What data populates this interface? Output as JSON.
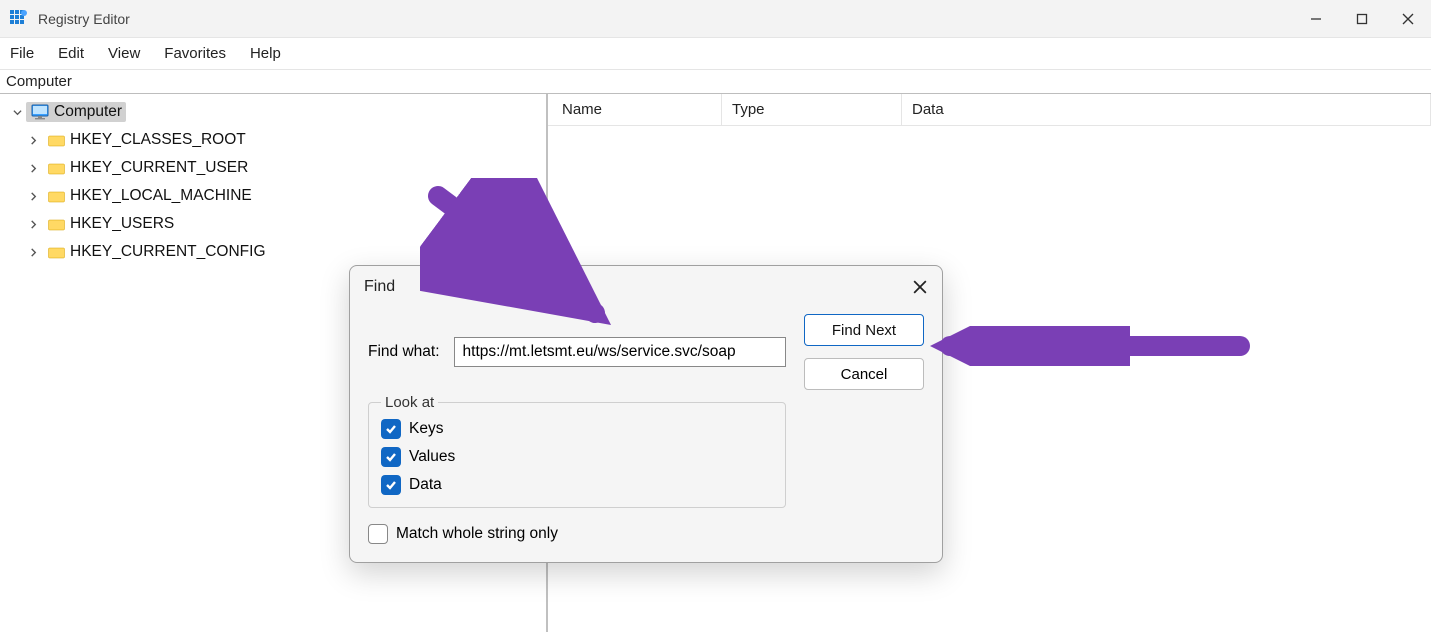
{
  "window": {
    "title": "Registry Editor"
  },
  "menu": {
    "file": "File",
    "edit": "Edit",
    "view": "View",
    "favorites": "Favorites",
    "help": "Help"
  },
  "address": "Computer",
  "tree": {
    "root": "Computer",
    "children": [
      "HKEY_CLASSES_ROOT",
      "HKEY_CURRENT_USER",
      "HKEY_LOCAL_MACHINE",
      "HKEY_USERS",
      "HKEY_CURRENT_CONFIG"
    ]
  },
  "columns": {
    "name": "Name",
    "type": "Type",
    "data": "Data"
  },
  "dialog": {
    "title": "Find",
    "find_what_label": "Find what:",
    "find_what_value": "https://mt.letsmt.eu/ws/service.svc/soap",
    "find_next": "Find Next",
    "cancel": "Cancel",
    "look_at": "Look at",
    "keys": "Keys",
    "values": "Values",
    "data": "Data",
    "match_whole": "Match whole string only"
  }
}
